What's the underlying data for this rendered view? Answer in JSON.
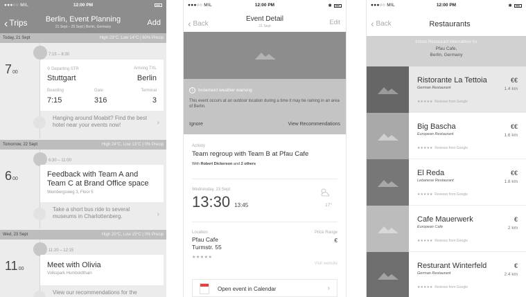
{
  "status": {
    "carrier": "●●●○○ MIL",
    "time": "12:00 PM"
  },
  "screen1": {
    "back_label": "Trips",
    "title": "Berlin, Event Planning",
    "subtitle": "21 Sept – 25 Sept | Berlin, Germany",
    "add_label": "Add",
    "days": [
      {
        "date": "Today, 21 Sept",
        "weather": "High 23°C, Low 14°C | 60% Precip"
      },
      {
        "date": "Tomorrow, 22 Sept",
        "weather": "High 24°C, Low 13°C | 0% Precip"
      },
      {
        "date": "Wed, 23 Sept",
        "weather": "High 20°C, Low 15°C | 0% Precip"
      }
    ],
    "events": [
      {
        "hour": "7",
        "minutes": "00",
        "time_range": "7:15 – 8:30",
        "depart_label": "Departing STR",
        "arrive_label": "Arriving TXL",
        "from": "Stuttgart",
        "to": "Berlin",
        "boarding_label": "Boarding",
        "gate_label": "Gate",
        "terminal_label": "Terminal",
        "boarding": "7:15",
        "gate": "316",
        "terminal": "3",
        "suggestion": "Hanging around Moabit? Find the best hotel near your events now!"
      },
      {
        "hour": "6",
        "minutes": "00",
        "time_range": "6:30 – 11:00",
        "title": "Feedback with Team A and Team C at Brand Office space",
        "address": "Weinbergsweg 3, Floor 5",
        "suggestion": "Take a short bus ride to several museums in Charlottenberg."
      },
      {
        "hour": "11",
        "minutes": "00",
        "time_range": "11:20 – 12:15",
        "title": "Meet with Olivia",
        "address": "Volkspark Humboldthain",
        "suggestion": "View our recommendations for the"
      }
    ]
  },
  "screen2": {
    "back_label": "Back",
    "title": "Event Detail",
    "subtitle": "21 Sept",
    "edit_label": "Edit",
    "warning_title": "Inclement weather warning",
    "warning_body": "This event occurs at an outdoor location during a time it may be raining in an area of Berlin.",
    "ignore_label": "Ignore",
    "view_label": "View Recommendations",
    "activity_label": "Activity",
    "activity_title": "Team regroup with Team B at Pfau Cafe",
    "with_prefix": "With ",
    "with_name": "Robert Dickerson",
    "with_mid": " and ",
    "with_others": "2 others",
    "date_label": "Wednesday, 23 Sept",
    "start_time": "13:30",
    "end_time": "13:45",
    "temperature": "17°",
    "location_label": "Location",
    "location_name": "Pfau Cafe",
    "location_street": "Turmstr. 55",
    "rating": "★★★★★",
    "price_label": "Price Range",
    "price": "€",
    "visit_label": "Visit website",
    "calendar_label": "Open event in Calendar"
  },
  "screen3": {
    "back_label": "Back",
    "title": "Restaurants",
    "info_line1": "Indoor Restaurant Alternatives for",
    "info_line2": "Pfau Cafe,",
    "info_line3": "Berlin, Germany",
    "restaurants": [
      {
        "name": "Ristorante La Tettoia",
        "type": "German Restaurant",
        "price": "€€",
        "distance": "1.4 km",
        "stars": "★★★★★",
        "reviews": "Reviews from Google"
      },
      {
        "name": "Big Bascha",
        "type": "European Restaurant",
        "price": "€€",
        "distance": "1.6 km",
        "stars": "★★★★★",
        "reviews": "Reviews from Google"
      },
      {
        "name": "El Reda",
        "type": "Lebanese Restaurant",
        "price": "€€",
        "distance": "1.8 km",
        "stars": "★★★★★",
        "reviews": "Reviews from Google"
      },
      {
        "name": "Cafe Mauerwerk",
        "type": "European Cafe",
        "price": "€",
        "distance": "2 km",
        "stars": "★★★★★",
        "reviews": "Reviews from Google"
      },
      {
        "name": "Resturant Winterfeld",
        "type": "German Restaurant",
        "price": "€",
        "distance": "2.4 km",
        "stars": "★★★★★",
        "reviews": "Reviews from Google"
      }
    ]
  },
  "colors": {
    "header_gray": "#8d8d8d",
    "day_header": "#bdbdbd",
    "accent_red": "#e5433a"
  }
}
